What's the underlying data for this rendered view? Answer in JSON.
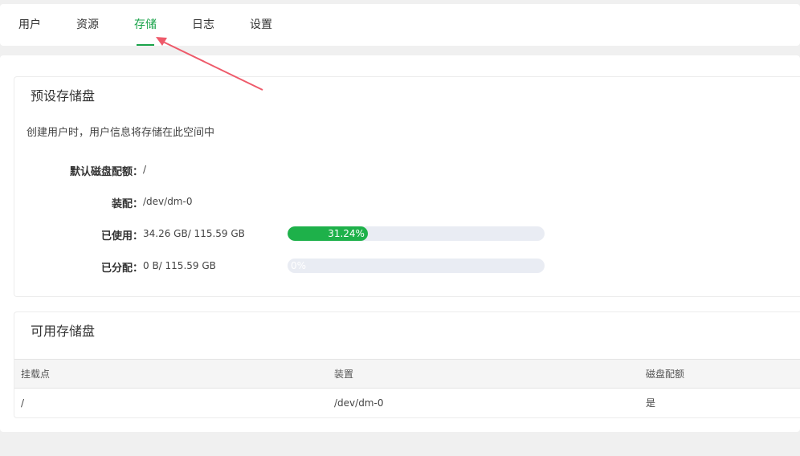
{
  "tabs": [
    {
      "label": "用户"
    },
    {
      "label": "资源"
    },
    {
      "label": "存储"
    },
    {
      "label": "日志"
    },
    {
      "label": "设置"
    }
  ],
  "active_tab": "存储",
  "preset": {
    "title": "预设存储盘",
    "description": "创建用户时，用户信息将存储在此空间中",
    "quota_label": "默认磁盘配额：",
    "quota_value": "/",
    "mount_label": "装配：",
    "mount_value": "/dev/dm-0",
    "used_label": "已使用：",
    "used_value": "34.26 GB/ 115.59 GB",
    "used_percent_text": "31.24%",
    "used_percent": 31.24,
    "allocated_label": "已分配：",
    "allocated_value": "0 B/ 115.59 GB",
    "allocated_percent_text": "0%",
    "allocated_percent": 0
  },
  "available": {
    "title": "可用存储盘",
    "columns": [
      "挂载点",
      "装置",
      "磁盘配额"
    ],
    "rows": [
      [
        "/",
        "/dev/dm-0",
        "是"
      ]
    ]
  },
  "colors": {
    "accent": "#1aa34a",
    "progress_fill": "#1eb14a",
    "progress_track": "#e9ecf3",
    "annotation_arrow": "#ee5a6a"
  }
}
